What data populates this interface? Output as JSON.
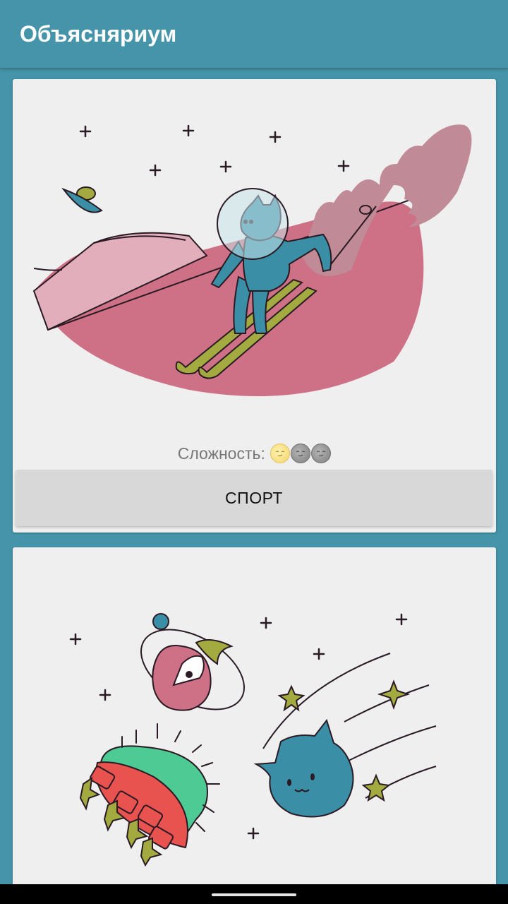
{
  "app_bar": {
    "title": "Объясняриум"
  },
  "cards": [
    {
      "illustration": "cat-astronaut-skiing-in-space",
      "difficulty_label": "Сложность:",
      "difficulty_level": 1,
      "difficulty_max": 3,
      "category_label": "СПОРТ"
    },
    {
      "illustration": "space-cat-planet-ufo-stars"
    }
  ],
  "colors": {
    "app_bar": "#4594a9",
    "background": "#4594a9",
    "card": "#efefef",
    "button": "#d8d8d8",
    "pink": "#cf7186",
    "teal": "#3a8fa6",
    "olive": "#a3aa3f",
    "green": "#4ecb94",
    "red": "#e8524f",
    "outline": "#2a1a24"
  }
}
